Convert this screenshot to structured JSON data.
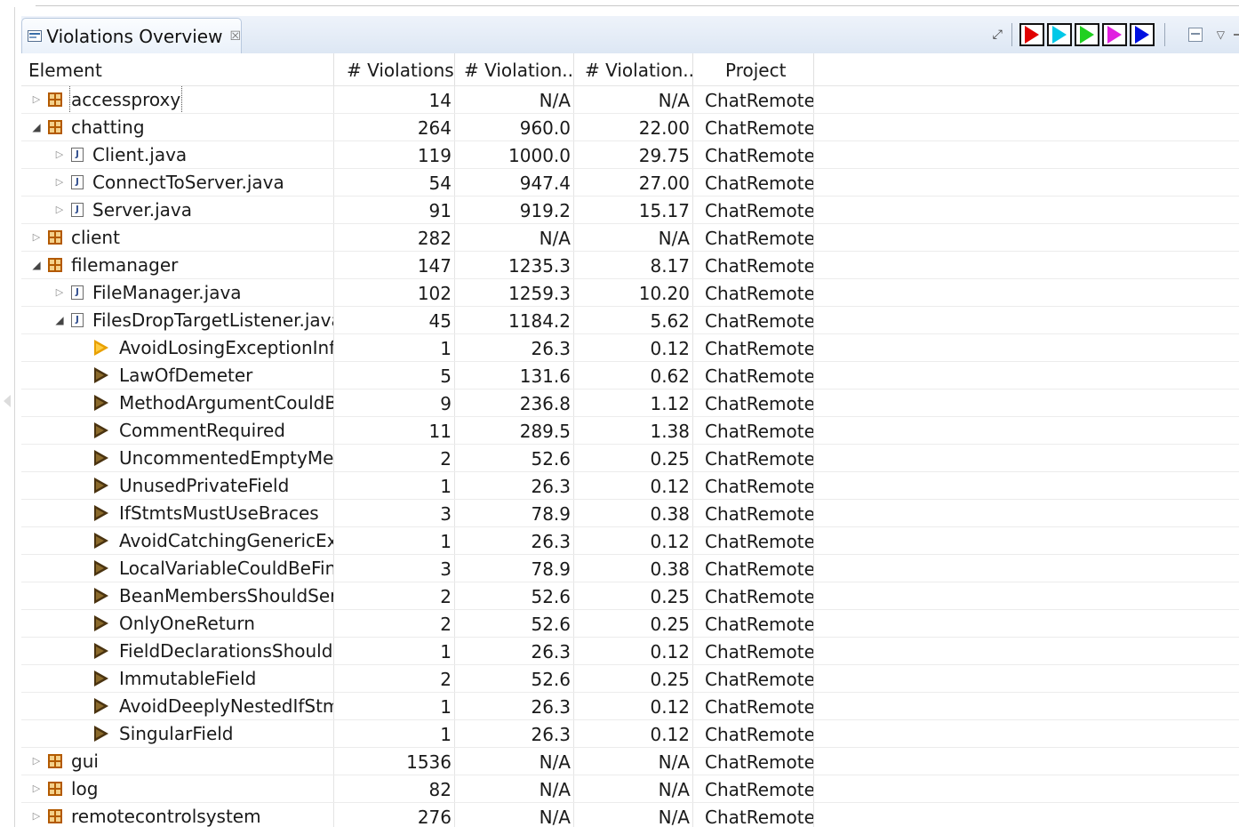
{
  "view": {
    "title": "Violations Overview",
    "close_glyph": "☒",
    "pin_glyph": "⤢",
    "menu_glyph": "▽",
    "play_buttons": [
      {
        "name": "red",
        "color": "#e00000"
      },
      {
        "name": "cyan",
        "color": "#00c8e8"
      },
      {
        "name": "green",
        "color": "#20d020"
      },
      {
        "name": "magenta",
        "color": "#e020e0"
      },
      {
        "name": "blue",
        "color": "#0010e0"
      }
    ]
  },
  "columns": [
    "Element",
    "# Violations",
    "# Violation...",
    "# Violation...",
    "Project"
  ],
  "rows": [
    {
      "level": 0,
      "kind": "package",
      "exp": "closed",
      "name": "accessproxy",
      "focus": true,
      "v1": "14",
      "v2": "N/A",
      "v3": "N/A",
      "project": "ChatRemote"
    },
    {
      "level": 0,
      "kind": "package",
      "exp": "open",
      "name": "chatting",
      "v1": "264",
      "v2": "960.0",
      "v3": "22.00",
      "project": "ChatRemote"
    },
    {
      "level": 1,
      "kind": "java",
      "exp": "closed",
      "name": "Client.java",
      "v1": "119",
      "v2": "1000.0",
      "v3": "29.75",
      "project": "ChatRemote"
    },
    {
      "level": 1,
      "kind": "java",
      "exp": "closed",
      "name": "ConnectToServer.java",
      "v1": "54",
      "v2": "947.4",
      "v3": "27.00",
      "project": "ChatRemote"
    },
    {
      "level": 1,
      "kind": "java",
      "exp": "closed",
      "name": "Server.java",
      "v1": "91",
      "v2": "919.2",
      "v3": "15.17",
      "project": "ChatRemote"
    },
    {
      "level": 0,
      "kind": "package",
      "exp": "closed",
      "name": "client",
      "v1": "282",
      "v2": "N/A",
      "v3": "N/A",
      "project": "ChatRemote"
    },
    {
      "level": 0,
      "kind": "package",
      "exp": "open",
      "name": "filemanager",
      "v1": "147",
      "v2": "1235.3",
      "v3": "8.17",
      "project": "ChatRemote"
    },
    {
      "level": 1,
      "kind": "java",
      "exp": "closed",
      "name": "FileManager.java",
      "v1": "102",
      "v2": "1259.3",
      "v3": "10.20",
      "project": "ChatRemote"
    },
    {
      "level": 1,
      "kind": "java",
      "exp": "open",
      "name": "FilesDropTargetListener.java",
      "v1": "45",
      "v2": "1184.2",
      "v3": "5.62",
      "project": "ChatRemote"
    },
    {
      "level": 2,
      "kind": "rule-orange",
      "exp": "none",
      "name": "AvoidLosingExceptionInfo",
      "v1": "1",
      "v2": "26.3",
      "v3": "0.12",
      "project": "ChatRemote"
    },
    {
      "level": 2,
      "kind": "rule",
      "exp": "none",
      "name": "LawOfDemeter",
      "v1": "5",
      "v2": "131.6",
      "v3": "0.62",
      "project": "ChatRemote"
    },
    {
      "level": 2,
      "kind": "rule",
      "exp": "none",
      "name": "MethodArgumentCouldBe",
      "v1": "9",
      "v2": "236.8",
      "v3": "1.12",
      "project": "ChatRemote"
    },
    {
      "level": 2,
      "kind": "rule",
      "exp": "none",
      "name": "CommentRequired",
      "v1": "11",
      "v2": "289.5",
      "v3": "1.38",
      "project": "ChatRemote"
    },
    {
      "level": 2,
      "kind": "rule",
      "exp": "none",
      "name": "UncommentedEmptyMeth",
      "v1": "2",
      "v2": "52.6",
      "v3": "0.25",
      "project": "ChatRemote"
    },
    {
      "level": 2,
      "kind": "rule",
      "exp": "none",
      "name": "UnusedPrivateField",
      "v1": "1",
      "v2": "26.3",
      "v3": "0.12",
      "project": "ChatRemote"
    },
    {
      "level": 2,
      "kind": "rule",
      "exp": "none",
      "name": "IfStmtsMustUseBraces",
      "v1": "3",
      "v2": "78.9",
      "v3": "0.38",
      "project": "ChatRemote"
    },
    {
      "level": 2,
      "kind": "rule",
      "exp": "none",
      "name": "AvoidCatchingGenericExce",
      "v1": "1",
      "v2": "26.3",
      "v3": "0.12",
      "project": "ChatRemote"
    },
    {
      "level": 2,
      "kind": "rule",
      "exp": "none",
      "name": "LocalVariableCouldBeFina",
      "v1": "3",
      "v2": "78.9",
      "v3": "0.38",
      "project": "ChatRemote"
    },
    {
      "level": 2,
      "kind": "rule",
      "exp": "none",
      "name": "BeanMembersShouldSeria",
      "v1": "2",
      "v2": "52.6",
      "v3": "0.25",
      "project": "ChatRemote"
    },
    {
      "level": 2,
      "kind": "rule",
      "exp": "none",
      "name": "OnlyOneReturn",
      "v1": "2",
      "v2": "52.6",
      "v3": "0.25",
      "project": "ChatRemote"
    },
    {
      "level": 2,
      "kind": "rule",
      "exp": "none",
      "name": "FieldDeclarationsShouldBe",
      "v1": "1",
      "v2": "26.3",
      "v3": "0.12",
      "project": "ChatRemote"
    },
    {
      "level": 2,
      "kind": "rule",
      "exp": "none",
      "name": "ImmutableField",
      "v1": "2",
      "v2": "52.6",
      "v3": "0.25",
      "project": "ChatRemote"
    },
    {
      "level": 2,
      "kind": "rule",
      "exp": "none",
      "name": "AvoidDeeplyNestedIfStmts",
      "v1": "1",
      "v2": "26.3",
      "v3": "0.12",
      "project": "ChatRemote"
    },
    {
      "level": 2,
      "kind": "rule",
      "exp": "none",
      "name": "SingularField",
      "v1": "1",
      "v2": "26.3",
      "v3": "0.12",
      "project": "ChatRemote"
    },
    {
      "level": 0,
      "kind": "package",
      "exp": "closed",
      "name": "gui",
      "v1": "1536",
      "v2": "N/A",
      "v3": "N/A",
      "project": "ChatRemote"
    },
    {
      "level": 0,
      "kind": "package",
      "exp": "closed",
      "name": "log",
      "v1": "82",
      "v2": "N/A",
      "v3": "N/A",
      "project": "ChatRemote"
    },
    {
      "level": 0,
      "kind": "package",
      "exp": "closed",
      "name": "remotecontrolsystem",
      "v1": "276",
      "v2": "N/A",
      "v3": "N/A",
      "project": "ChatRemote"
    }
  ]
}
